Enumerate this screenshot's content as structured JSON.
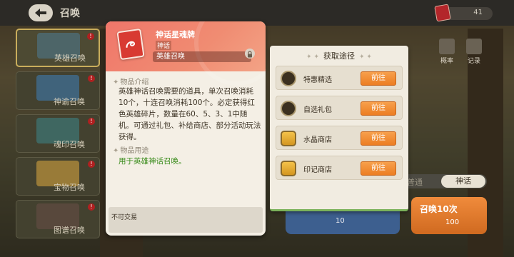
{
  "topbar": {
    "title": "召唤",
    "currency_value": "41"
  },
  "sidebar": {
    "items": [
      {
        "label": "英雄召唤",
        "active": true,
        "thumb_color": "#4e6a72"
      },
      {
        "label": "神谕召唤",
        "active": false,
        "thumb_color": "#3f6a88"
      },
      {
        "label": "魂印召唤",
        "active": false,
        "thumb_color": "#3e6e6a"
      },
      {
        "label": "宝物召唤",
        "active": false,
        "thumb_color": "#a8863a"
      },
      {
        "label": "图谱召唤",
        "active": false,
        "thumb_color": "#5c4a3e"
      }
    ]
  },
  "right_tools": {
    "prob_label": "概率",
    "record_label": "记录"
  },
  "background_controls": {
    "seg_left": "普通",
    "seg_right": "神话",
    "blue_btn_value": "10",
    "orange_btn_label": "召唤10次",
    "orange_btn_value": "100"
  },
  "item": {
    "name": "神话星魂牌",
    "rarity": "神话",
    "type": "英雄召唤",
    "intro_title": "物品介绍",
    "description": "英雄神话召唤需要的道具，单次召唤消耗10个，十连召唤消耗100个。必定获得红色英雄碎片，数量在60、5、3、1中随机。可通过礼包、补给商店、部分活动玩法获得。",
    "usage_title": "物品用途",
    "usage": "用于英雄神话召唤。",
    "trade_note": "不可交易"
  },
  "acquire": {
    "title": "获取途径",
    "sources": [
      {
        "label": "特惠精选",
        "icon": "gift-icon",
        "go": "前往"
      },
      {
        "label": "自选礼包",
        "icon": "gift-icon",
        "go": "前往"
      },
      {
        "label": "水晶商店",
        "icon": "shop-icon",
        "go": "前往"
      },
      {
        "label": "印记商店",
        "icon": "shop-icon",
        "go": "前往"
      }
    ]
  },
  "colors": {
    "accent_orange": "#ec7d22",
    "card_header": "#f0766a",
    "usage_green": "#3a8c1c"
  }
}
